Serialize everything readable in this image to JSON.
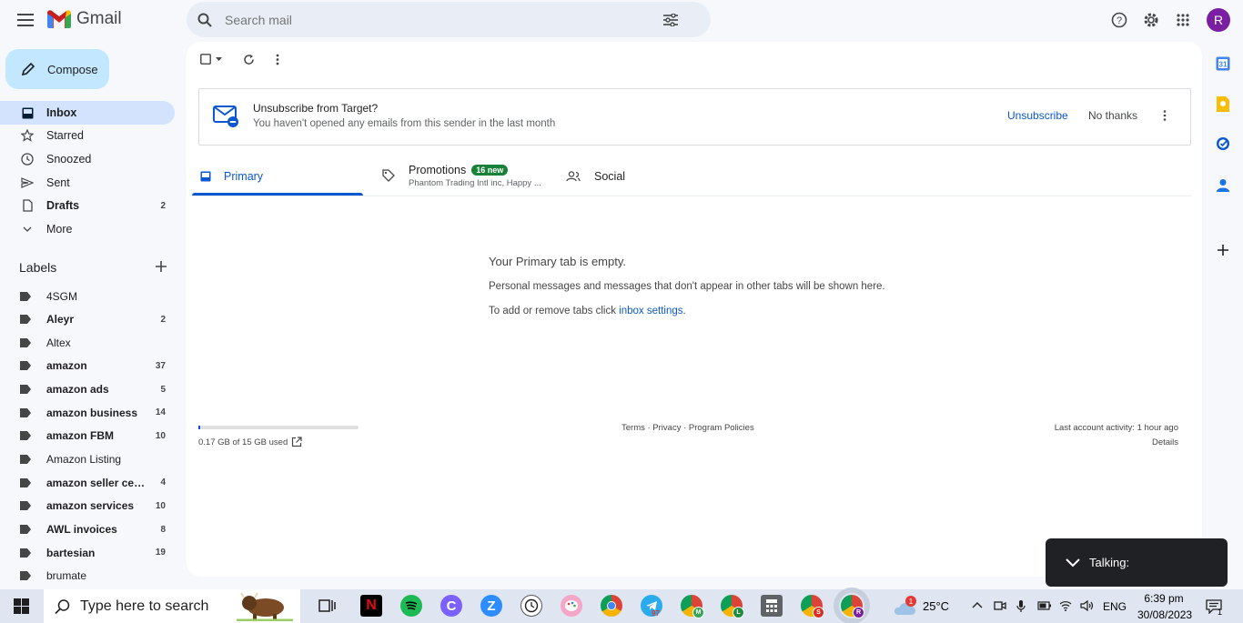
{
  "app": {
    "name": "Gmail"
  },
  "search": {
    "placeholder": "Search mail"
  },
  "account": {
    "avatar_letter": "R",
    "avatar_color": "#7b1fa2"
  },
  "compose": {
    "label": "Compose"
  },
  "nav": [
    {
      "label": "Inbox",
      "count": "",
      "icon": "inbox-icon",
      "active": true,
      "bold": true
    },
    {
      "label": "Starred",
      "count": "",
      "icon": "star-icon",
      "active": false,
      "bold": false
    },
    {
      "label": "Snoozed",
      "count": "",
      "icon": "clock-icon",
      "active": false,
      "bold": false
    },
    {
      "label": "Sent",
      "count": "",
      "icon": "send-icon",
      "active": false,
      "bold": false
    },
    {
      "label": "Drafts",
      "count": "2",
      "icon": "file-icon",
      "active": false,
      "bold": true
    },
    {
      "label": "More",
      "count": "",
      "icon": "chevron-down-icon",
      "active": false,
      "bold": false
    }
  ],
  "labels": {
    "heading": "Labels",
    "items": [
      {
        "label": "4SGM",
        "count": "",
        "bold": false
      },
      {
        "label": "Aleyr",
        "count": "2",
        "bold": true
      },
      {
        "label": "Altex",
        "count": "",
        "bold": false
      },
      {
        "label": "amazon",
        "count": "37",
        "bold": true
      },
      {
        "label": "amazon ads",
        "count": "5",
        "bold": true
      },
      {
        "label": "amazon business",
        "count": "14",
        "bold": true
      },
      {
        "label": "amazon FBM",
        "count": "10",
        "bold": true
      },
      {
        "label": "Amazon Listing",
        "count": "",
        "bold": false
      },
      {
        "label": "amazon seller cent...",
        "count": "4",
        "bold": true
      },
      {
        "label": "amazon services",
        "count": "10",
        "bold": true
      },
      {
        "label": "AWL invoices",
        "count": "8",
        "bold": true
      },
      {
        "label": "bartesian",
        "count": "19",
        "bold": true
      },
      {
        "label": "brumate",
        "count": "",
        "bold": false
      }
    ]
  },
  "banner": {
    "title": "Unsubscribe from Target?",
    "subtitle": "You haven't opened any emails from this sender in the last month",
    "unsubscribe": "Unsubscribe",
    "no_thanks": "No thanks"
  },
  "tabs": {
    "primary": "Primary",
    "promotions": "Promotions",
    "promotions_badge": "16 new",
    "promotions_preview": "Phantom Trading Intl inc, Happy ...",
    "social": "Social"
  },
  "empty": {
    "title": "Your Primary tab is empty.",
    "line1": "Personal messages and messages that don't appear in other tabs will be shown here.",
    "line2_prefix": "To add or remove tabs click ",
    "line2_link": "inbox settings",
    "line2_suffix": "."
  },
  "footer": {
    "storage": "0.17 GB of 15 GB used",
    "storage_fraction": 0.011,
    "links": "Terms · Privacy · Program Policies",
    "activity": "Last account activity: 1 hour ago",
    "details": "Details"
  },
  "toast": {
    "text": "Talking:"
  },
  "taskbar": {
    "search_placeholder": "Type here to search",
    "telegram_badge": "97",
    "weather_badge": "1",
    "temperature": "25°C",
    "language": "ENG",
    "time": "6:39 pm",
    "date": "30/08/2023",
    "notification_count": "1",
    "chrome_profiles": [
      "M",
      "L",
      "S",
      "R"
    ]
  }
}
